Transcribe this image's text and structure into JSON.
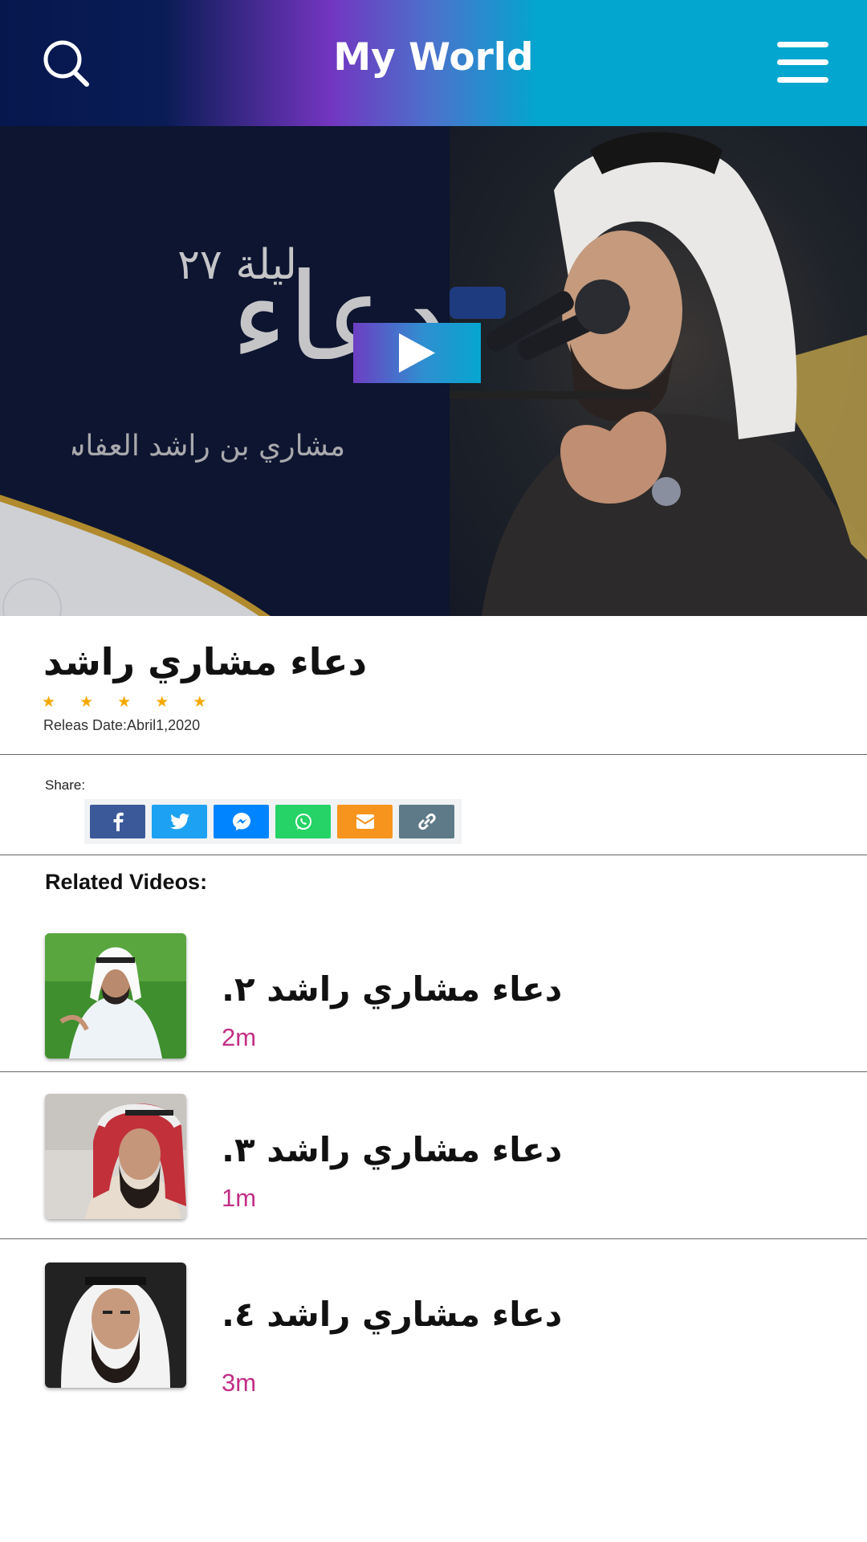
{
  "header": {
    "title": "My World",
    "search_icon": "search-icon",
    "menu_icon": "hamburger-menu-icon"
  },
  "hero": {
    "play_icon": "play-icon",
    "overlay_text_main": "دعاء",
    "overlay_text_night": "ليلة ٢٧",
    "overlay_text_reciter": "مشاري بن راشد العفاسي"
  },
  "video": {
    "title": "دعاء مشاري راشد",
    "rating_stars": "★ ★ ★ ★ ★",
    "rating": 5,
    "release": "Releas Date:Abril1,2020"
  },
  "share": {
    "label": "Share:",
    "buttons": [
      {
        "name": "facebook",
        "icon": "facebook-icon",
        "color": "#3b5998"
      },
      {
        "name": "twitter",
        "icon": "twitter-icon",
        "color": "#1da1f2"
      },
      {
        "name": "messenger",
        "icon": "messenger-icon",
        "color": "#0084ff"
      },
      {
        "name": "whatsapp",
        "icon": "whatsapp-icon",
        "color": "#25d366"
      },
      {
        "name": "email",
        "icon": "email-icon",
        "color": "#f7941d"
      },
      {
        "name": "copy-link",
        "icon": "link-icon",
        "color": "#5e7a88"
      }
    ]
  },
  "related": {
    "title": "Related Videos:",
    "items": [
      {
        "title": "دعاء مشاري راشد ٢.",
        "duration": "2m"
      },
      {
        "title": "دعاء مشاري راشد ٣.",
        "duration": "1m"
      },
      {
        "title": "دعاء مشاري راشد ٤.",
        "duration": "3m"
      }
    ]
  },
  "colors": {
    "accent_pink": "#c22f86",
    "star": "#f4a900",
    "header_gradient": [
      "#05174d",
      "#7335c0",
      "#03a6cf"
    ]
  }
}
